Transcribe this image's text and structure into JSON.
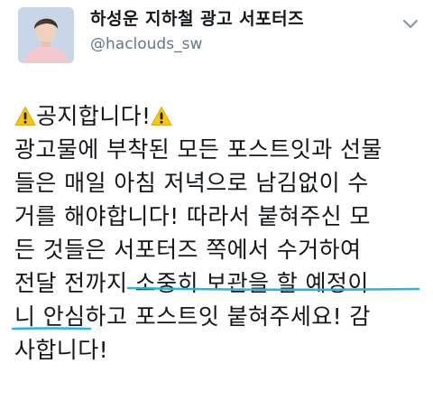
{
  "profile": {
    "display_name": "하성운 지하철 광고 서포터즈",
    "handle": "@haclouds_sw",
    "avatar_icon": "profile-photo",
    "menu_icon": "chevron-down-icon"
  },
  "tweet": {
    "line1_text": "공지합니다!",
    "warning_icon": "warning-icon",
    "line2": "광고물에 부착된 모든 포스트잇과 선물",
    "line3": "들은 매일 아침 저녁으로 남김없이 수",
    "line4": "거를 해야합니다! 따라서 붙혀주신 모",
    "line5": "든 것들은 서포터즈 쪽에서 수거하여",
    "line6": "전달 전까지 소중히 보관을 할 예정이",
    "line7": "니 안심하고 포스트잇 붙혀주세요! 감",
    "line8": "사합니다!"
  },
  "colors": {
    "text": "#14171a",
    "handle": "#657786",
    "highlight": "#2bb5d6",
    "warning_fill": "#f4c51a",
    "chevron": "#8899a6"
  }
}
